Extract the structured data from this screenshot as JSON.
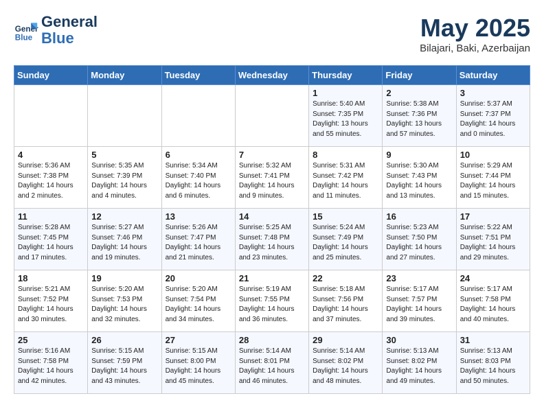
{
  "header": {
    "logo_line1": "General",
    "logo_line2": "Blue",
    "month": "May 2025",
    "location": "Bilajari, Baki, Azerbaijan"
  },
  "weekdays": [
    "Sunday",
    "Monday",
    "Tuesday",
    "Wednesday",
    "Thursday",
    "Friday",
    "Saturday"
  ],
  "weeks": [
    [
      {
        "day": "",
        "info": ""
      },
      {
        "day": "",
        "info": ""
      },
      {
        "day": "",
        "info": ""
      },
      {
        "day": "",
        "info": ""
      },
      {
        "day": "1",
        "info": "Sunrise: 5:40 AM\nSunset: 7:35 PM\nDaylight: 13 hours\nand 55 minutes."
      },
      {
        "day": "2",
        "info": "Sunrise: 5:38 AM\nSunset: 7:36 PM\nDaylight: 13 hours\nand 57 minutes."
      },
      {
        "day": "3",
        "info": "Sunrise: 5:37 AM\nSunset: 7:37 PM\nDaylight: 14 hours\nand 0 minutes."
      }
    ],
    [
      {
        "day": "4",
        "info": "Sunrise: 5:36 AM\nSunset: 7:38 PM\nDaylight: 14 hours\nand 2 minutes."
      },
      {
        "day": "5",
        "info": "Sunrise: 5:35 AM\nSunset: 7:39 PM\nDaylight: 14 hours\nand 4 minutes."
      },
      {
        "day": "6",
        "info": "Sunrise: 5:34 AM\nSunset: 7:40 PM\nDaylight: 14 hours\nand 6 minutes."
      },
      {
        "day": "7",
        "info": "Sunrise: 5:32 AM\nSunset: 7:41 PM\nDaylight: 14 hours\nand 9 minutes."
      },
      {
        "day": "8",
        "info": "Sunrise: 5:31 AM\nSunset: 7:42 PM\nDaylight: 14 hours\nand 11 minutes."
      },
      {
        "day": "9",
        "info": "Sunrise: 5:30 AM\nSunset: 7:43 PM\nDaylight: 14 hours\nand 13 minutes."
      },
      {
        "day": "10",
        "info": "Sunrise: 5:29 AM\nSunset: 7:44 PM\nDaylight: 14 hours\nand 15 minutes."
      }
    ],
    [
      {
        "day": "11",
        "info": "Sunrise: 5:28 AM\nSunset: 7:45 PM\nDaylight: 14 hours\nand 17 minutes."
      },
      {
        "day": "12",
        "info": "Sunrise: 5:27 AM\nSunset: 7:46 PM\nDaylight: 14 hours\nand 19 minutes."
      },
      {
        "day": "13",
        "info": "Sunrise: 5:26 AM\nSunset: 7:47 PM\nDaylight: 14 hours\nand 21 minutes."
      },
      {
        "day": "14",
        "info": "Sunrise: 5:25 AM\nSunset: 7:48 PM\nDaylight: 14 hours\nand 23 minutes."
      },
      {
        "day": "15",
        "info": "Sunrise: 5:24 AM\nSunset: 7:49 PM\nDaylight: 14 hours\nand 25 minutes."
      },
      {
        "day": "16",
        "info": "Sunrise: 5:23 AM\nSunset: 7:50 PM\nDaylight: 14 hours\nand 27 minutes."
      },
      {
        "day": "17",
        "info": "Sunrise: 5:22 AM\nSunset: 7:51 PM\nDaylight: 14 hours\nand 29 minutes."
      }
    ],
    [
      {
        "day": "18",
        "info": "Sunrise: 5:21 AM\nSunset: 7:52 PM\nDaylight: 14 hours\nand 30 minutes."
      },
      {
        "day": "19",
        "info": "Sunrise: 5:20 AM\nSunset: 7:53 PM\nDaylight: 14 hours\nand 32 minutes."
      },
      {
        "day": "20",
        "info": "Sunrise: 5:20 AM\nSunset: 7:54 PM\nDaylight: 14 hours\nand 34 minutes."
      },
      {
        "day": "21",
        "info": "Sunrise: 5:19 AM\nSunset: 7:55 PM\nDaylight: 14 hours\nand 36 minutes."
      },
      {
        "day": "22",
        "info": "Sunrise: 5:18 AM\nSunset: 7:56 PM\nDaylight: 14 hours\nand 37 minutes."
      },
      {
        "day": "23",
        "info": "Sunrise: 5:17 AM\nSunset: 7:57 PM\nDaylight: 14 hours\nand 39 minutes."
      },
      {
        "day": "24",
        "info": "Sunrise: 5:17 AM\nSunset: 7:58 PM\nDaylight: 14 hours\nand 40 minutes."
      }
    ],
    [
      {
        "day": "25",
        "info": "Sunrise: 5:16 AM\nSunset: 7:58 PM\nDaylight: 14 hours\nand 42 minutes."
      },
      {
        "day": "26",
        "info": "Sunrise: 5:15 AM\nSunset: 7:59 PM\nDaylight: 14 hours\nand 43 minutes."
      },
      {
        "day": "27",
        "info": "Sunrise: 5:15 AM\nSunset: 8:00 PM\nDaylight: 14 hours\nand 45 minutes."
      },
      {
        "day": "28",
        "info": "Sunrise: 5:14 AM\nSunset: 8:01 PM\nDaylight: 14 hours\nand 46 minutes."
      },
      {
        "day": "29",
        "info": "Sunrise: 5:14 AM\nSunset: 8:02 PM\nDaylight: 14 hours\nand 48 minutes."
      },
      {
        "day": "30",
        "info": "Sunrise: 5:13 AM\nSunset: 8:02 PM\nDaylight: 14 hours\nand 49 minutes."
      },
      {
        "day": "31",
        "info": "Sunrise: 5:13 AM\nSunset: 8:03 PM\nDaylight: 14 hours\nand 50 minutes."
      }
    ]
  ]
}
